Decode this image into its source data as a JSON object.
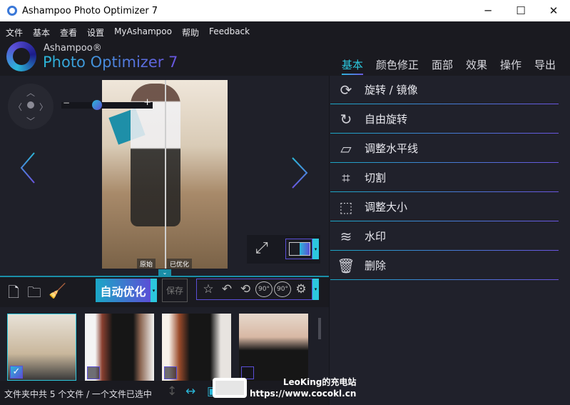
{
  "window": {
    "title": "Ashampoo Photo Optimizer 7",
    "minimize_glyph": "─",
    "maximize_glyph": "☐",
    "close_glyph": "✕"
  },
  "menu": [
    "文件",
    "基本",
    "查看",
    "设置",
    "MyAshampoo",
    "帮助",
    "Feedback"
  ],
  "brand": {
    "small": "Ashampoo®",
    "big": "Photo Optimizer 7"
  },
  "tabs": [
    {
      "label": "基本",
      "active": true
    },
    {
      "label": "颜色修正",
      "active": false
    },
    {
      "label": "面部",
      "active": false
    },
    {
      "label": "效果",
      "active": false
    },
    {
      "label": "操作",
      "active": false
    },
    {
      "label": "导出",
      "active": false
    }
  ],
  "preview": {
    "zoom_minus": "−",
    "zoom_plus": "+",
    "zoom_level_fraction": 0.38,
    "label_original": "原始",
    "label_optimized": "已优化",
    "prev_glyph": "〈",
    "next_glyph": "〉"
  },
  "toolbar": {
    "auto_optimize": "自动优化",
    "save": "保存",
    "dropdown_glyph": "▾",
    "rotate_left_label": "90°",
    "rotate_right_label": "90°"
  },
  "tools": [
    {
      "label": "旋转 / 镜像",
      "icon": "rotate-mirror-icon",
      "glyph": "⟳"
    },
    {
      "label": "自由旋转",
      "icon": "free-rotate-icon",
      "glyph": "↻"
    },
    {
      "label": "调整水平线",
      "icon": "horizon-icon",
      "glyph": "▱"
    },
    {
      "label": "切割",
      "icon": "crop-icon",
      "glyph": "⌗"
    },
    {
      "label": "调整大小",
      "icon": "resize-icon",
      "glyph": "⬚"
    },
    {
      "label": "水印",
      "icon": "watermark-icon",
      "glyph": "≋"
    },
    {
      "label": "删除",
      "icon": "trash-icon",
      "glyph": "🗑"
    }
  ],
  "thumbnails": [
    {
      "selected": true
    },
    {
      "selected": false
    },
    {
      "selected": false
    },
    {
      "selected": false
    }
  ],
  "status": {
    "text": "文件夹中共 5 个文件 / 一个文件已选中"
  },
  "overlay_watermark": {
    "line1": "LeoKing的充电站",
    "line2": "https://www.cocokl.cn"
  },
  "colors": {
    "accent_cyan": "#2cc7dd",
    "accent_purple": "#5b4fd6",
    "panel_bg": "#20212b",
    "menubar_bg": "#1a1a20"
  }
}
